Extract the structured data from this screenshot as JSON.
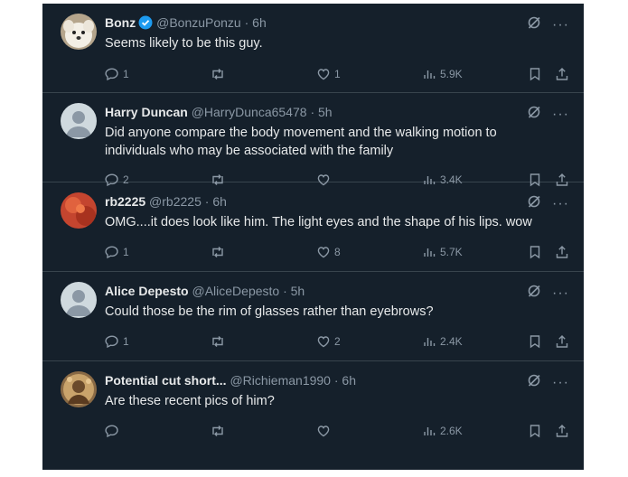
{
  "tweets": [
    {
      "name": "Bonz",
      "verified": true,
      "handle": "@BonzuPonzu",
      "dot": "·",
      "time": "6h",
      "text": "Seems likely to be this guy.",
      "replies": "1",
      "retweets": "",
      "likes": "1",
      "views": "5.9K",
      "avatar": "dog-avatar"
    },
    {
      "name": "Harry Duncan",
      "verified": false,
      "handle": "@HarryDunca65478",
      "dot": "·",
      "time": "5h",
      "text": "Did anyone compare the body movement and the walking motion to individuals who may be associated with the family",
      "replies": "2",
      "retweets": "",
      "likes": "",
      "views": "3.4K",
      "avatar": "default-avatar"
    },
    {
      "name": "rb2225",
      "verified": false,
      "handle": "@rb2225",
      "dot": "·",
      "time": "6h",
      "text": "OMG....it does look like him. The light eyes and the shape of his lips. wow",
      "replies": "1",
      "retweets": "",
      "likes": "8",
      "views": "5.7K",
      "avatar": "red-avatar"
    },
    {
      "name": "Alice Depesto",
      "verified": false,
      "handle": "@AliceDepesto",
      "dot": "·",
      "time": "5h",
      "text": "Could those be the rim of glasses rather than eyebrows?",
      "replies": "1",
      "retweets": "",
      "likes": "2",
      "views": "2.4K",
      "avatar": "default-avatar"
    },
    {
      "name": "Potential cut short...",
      "verified": false,
      "handle": "@Richieman1990",
      "dot": "·",
      "time": "6h",
      "text": "Are these recent pics of him?",
      "replies": "",
      "retweets": "",
      "likes": "",
      "views": "2.6K",
      "avatar": "portrait-avatar"
    }
  ],
  "colors": {
    "background": "#15202b",
    "divider": "#38444d",
    "text_primary": "#e7e9ea",
    "text_secondary": "#8b98a5",
    "verified_blue": "#1d9bf0"
  }
}
